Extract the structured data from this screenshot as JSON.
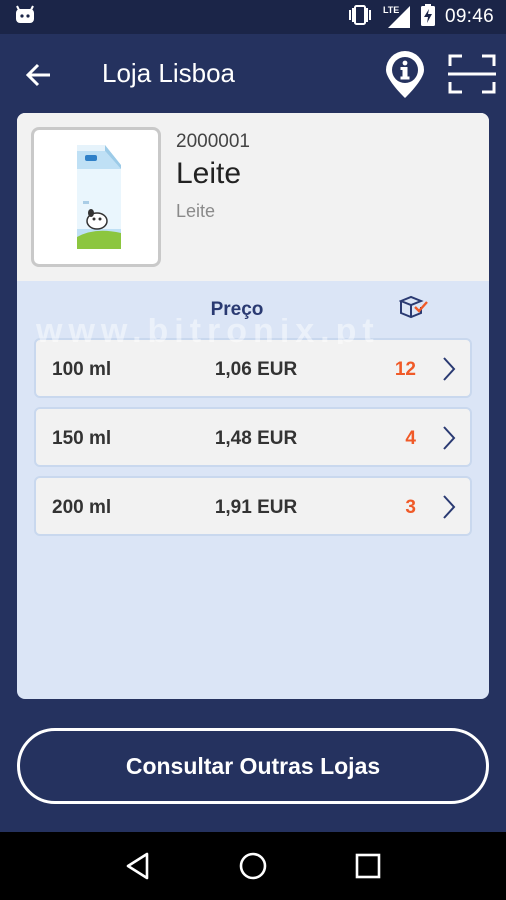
{
  "status_bar": {
    "time": "09:46",
    "network_label": "LTE",
    "icons": [
      "android-robot-icon",
      "vibrate-icon",
      "signal-icon",
      "battery-charging-icon"
    ]
  },
  "app_bar": {
    "title": "Loja Lisboa",
    "icons": [
      "back-arrow-icon",
      "info-location-icon",
      "scan-icon"
    ]
  },
  "product": {
    "code": "2000001",
    "name": "Leite",
    "description": "Leite",
    "image": "milk-carton"
  },
  "table": {
    "header_price": "Preço",
    "header_stock_icon": "box-check-icon",
    "rows": [
      {
        "size": "100 ml",
        "price": "1,06 EUR",
        "stock": "12"
      },
      {
        "size": "150 ml",
        "price": "1,48 EUR",
        "stock": "4"
      },
      {
        "size": "200 ml",
        "price": "1,91 EUR",
        "stock": "3"
      }
    ]
  },
  "watermark": "www.bitronix.pt",
  "consult_button": "Consultar Outras Lojas",
  "nav_bar": {
    "icons": [
      "back-triangle-icon",
      "home-circle-icon",
      "recents-square-icon"
    ]
  },
  "colors": {
    "background": "#25325f",
    "status_bar": "#1b2548",
    "card": "#dbe5f6",
    "header_text": "#2a3a72",
    "stock_accent": "#f05a28"
  }
}
